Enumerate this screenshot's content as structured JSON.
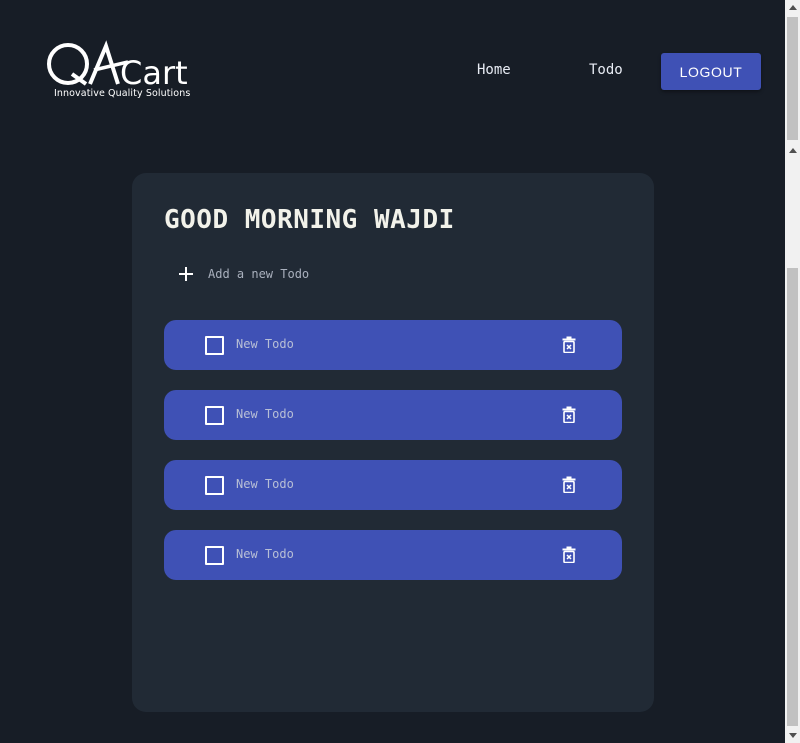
{
  "header": {
    "logo_text": "QACart",
    "logo_tagline": "Innovative Quality Solutions",
    "nav": {
      "home_label": "Home",
      "todo_label": "Todo"
    },
    "logout_label": "LOGOUT"
  },
  "main": {
    "greeting": "GOOD MORNING WAJDI",
    "add_todo": {
      "placeholder": "Add a new Todo",
      "icon": "plus-icon"
    },
    "todos": [
      {
        "text": "New Todo",
        "completed": false
      },
      {
        "text": "New Todo",
        "completed": false
      },
      {
        "text": "New Todo",
        "completed": false
      },
      {
        "text": "New Todo",
        "completed": false
      }
    ]
  },
  "colors": {
    "background": "#171d26",
    "card": "#212a35",
    "accent": "#3f51b5",
    "greeting_text": "#f2f2ea"
  }
}
